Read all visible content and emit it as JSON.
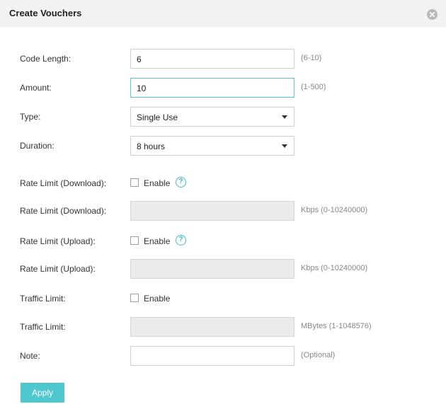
{
  "dialog": {
    "title": "Create Vouchers",
    "close_icon": "close-circle-icon"
  },
  "form": {
    "code_length": {
      "label": "Code Length:",
      "value": "6",
      "hint": "(6-10)"
    },
    "amount": {
      "label": "Amount:",
      "value": "10",
      "hint": "(1-500)"
    },
    "type": {
      "label": "Type:",
      "value": "Single Use"
    },
    "duration": {
      "label": "Duration:",
      "value": "8 hours"
    },
    "rate_limit_download_enable": {
      "label": "Rate Limit (Download):",
      "checkbox_label": "Enable",
      "checked": false
    },
    "rate_limit_download": {
      "label": "Rate Limit (Download):",
      "value": "",
      "hint": "Kbps (0-10240000)"
    },
    "rate_limit_upload_enable": {
      "label": "Rate Limit (Upload):",
      "checkbox_label": "Enable",
      "checked": false
    },
    "rate_limit_upload": {
      "label": "Rate Limit (Upload):",
      "value": "",
      "hint": "Kbps (0-10240000)"
    },
    "traffic_limit_enable": {
      "label": "Traffic Limit:",
      "checkbox_label": "Enable",
      "checked": false
    },
    "traffic_limit": {
      "label": "Traffic Limit:",
      "value": "",
      "hint": "MBytes (1-1048576)"
    },
    "note": {
      "label": "Note:",
      "value": "",
      "hint": "(Optional)"
    }
  },
  "actions": {
    "apply_label": "Apply"
  },
  "colors": {
    "accent": "#4fc7cf",
    "header_bg": "#f2f2f2",
    "disabled_field": "#ebebeb",
    "help_icon": "#3fb9c4"
  }
}
